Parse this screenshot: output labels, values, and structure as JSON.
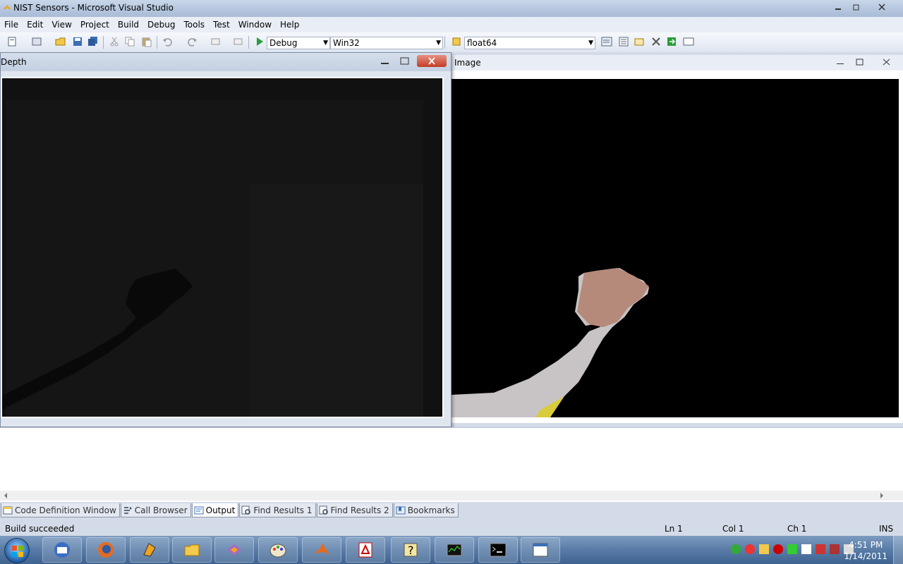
{
  "window": {
    "title": "NIST Sensors - Microsoft Visual Studio"
  },
  "menu": {
    "items": [
      "File",
      "Edit",
      "View",
      "Project",
      "Build",
      "Debug",
      "Tools",
      "Test",
      "Window",
      "Help"
    ]
  },
  "toolbar": {
    "config_combo": "Debug",
    "platform_combo": "Win32",
    "find_combo": "float64"
  },
  "depth_window": {
    "title": "Depth"
  },
  "image_window": {
    "title": "Image"
  },
  "tabs": {
    "items": [
      {
        "label": "Code Definition Window",
        "icon": "code-definition-icon"
      },
      {
        "label": "Call Browser",
        "icon": "call-browser-icon"
      },
      {
        "label": "Output",
        "icon": "output-icon",
        "active": true
      },
      {
        "label": "Find Results 1",
        "icon": "find-results-icon"
      },
      {
        "label": "Find Results 2",
        "icon": "find-results-icon"
      },
      {
        "label": "Bookmarks",
        "icon": "bookmarks-icon"
      }
    ]
  },
  "status": {
    "message": "Build succeeded",
    "line": "Ln 1",
    "col": "Col 1",
    "ch": "Ch 1",
    "mode": "INS"
  },
  "taskbar": {
    "time": "4:51 PM",
    "date": "1/14/2011"
  },
  "colors": {
    "accent": "#1f5fa8",
    "taskbar": "#5b7ea9"
  }
}
